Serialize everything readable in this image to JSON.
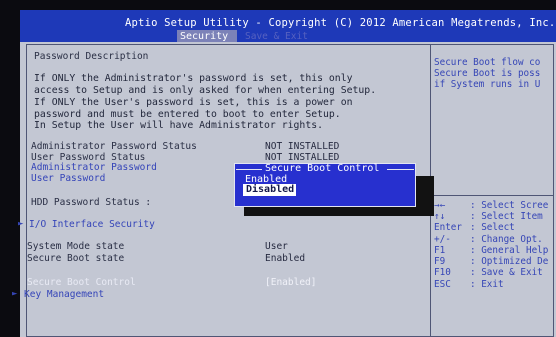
{
  "header": {
    "title": "Aptio Setup Utility - Copyright (C) 2012 American Megatrends, Inc.",
    "active_tab": "Security",
    "next_tab": "Save & Exit"
  },
  "main": {
    "section_title": "Password Description",
    "description_lines": [
      "If ONLY the Administrator's password is set, this only",
      "access to Setup and is only asked for when entering Setup.",
      "If ONLY the User's password is set, this is a power on",
      "password and must be entered to boot to enter Setup.",
      "In Setup the User will have Administrator rights."
    ],
    "admin_status_label": "Administrator Password Status",
    "admin_status_value": "NOT INSTALLED",
    "user_status_label": "User Password Status",
    "user_status_value": "NOT INSTALLED",
    "admin_password_label": "Administrator Password",
    "user_password_label": "User Password",
    "hdd_status_label": "HDD Password Status  :",
    "io_security_label": "I/O Interface Security",
    "system_mode_label": "System Mode state",
    "system_mode_value": "User",
    "secure_boot_state_label": "Secure Boot state",
    "secure_boot_state_value": "Enabled",
    "secure_boot_control_label": "Secure Boot Control",
    "secure_boot_control_value": "[Enabled]",
    "key_management_label": "Key Management"
  },
  "popup": {
    "title": "Secure Boot Control",
    "options": [
      "Enabled",
      "Disabled"
    ],
    "selected": "Disabled"
  },
  "help": {
    "lines": [
      "Secure Boot flow co",
      "Secure Boot is poss",
      "if System runs in U"
    ]
  },
  "keys": [
    {
      "key": "→←",
      "desc": ": Select Scree"
    },
    {
      "key": "↑↓",
      "desc": ": Select Item"
    },
    {
      "key": "Enter",
      "desc": ": Select"
    },
    {
      "key": "+/-",
      "desc": ": Change Opt."
    },
    {
      "key": "F1",
      "desc": ": General Help"
    },
    {
      "key": "F9",
      "desc": ": Optimized De"
    },
    {
      "key": "F10",
      "desc": ": Save & Exit"
    },
    {
      "key": "ESC",
      "desc": ": Exit"
    }
  ],
  "colors": {
    "header_bg": "#1e39b8",
    "panel_bg": "#c3c7d3",
    "popup_bg": "#2730cf",
    "accent_blue": "#3646b6"
  }
}
